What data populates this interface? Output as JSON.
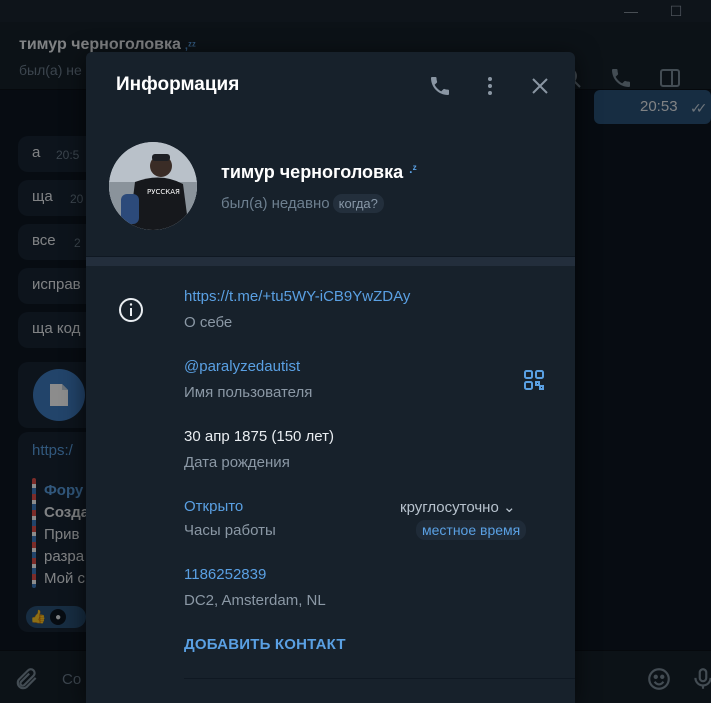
{
  "chat": {
    "name": "тимур черноголовка",
    "status_partial": "был(а) не",
    "messages": [
      {
        "text": "а",
        "time_partial": "20:5"
      },
      {
        "text": "ща",
        "time_partial": "20"
      },
      {
        "text": "все",
        "time_partial": "2"
      },
      {
        "text": "исправ"
      },
      {
        "text": "ща код"
      }
    ],
    "link_partial": "https:/",
    "preview_lines": [
      "Фору",
      "Созда",
      "Прив",
      "разра",
      "Мой с"
    ],
    "right_time": "20:53",
    "composer_placeholder": "Со"
  },
  "panel": {
    "title": "Информация",
    "name": "тимур черноголовка",
    "status": "был(а) недавно",
    "status_pill": "когда?",
    "bio_link": "https://t.me/+tu5WY-iCB9YwZDAy",
    "bio_label": "О себе",
    "username": "@paralyzedautist",
    "username_label": "Имя пользователя",
    "birthday": "30 апр 1875 (150 лет)",
    "birthday_label": "Дата рождения",
    "hours_status": "Открыто",
    "hours_label": "Часы работы",
    "hours_value": "круглосуточно",
    "hours_pill": "местное время",
    "user_id": "1186252839",
    "dc": "DC2, Amsterdam, NL",
    "add_contact": "ДОБАВИТЬ КОНТАКТ"
  },
  "colors": {
    "accent": "#5aa0e3",
    "panel_bg": "#17212b",
    "app_bg": "#0e1621"
  }
}
